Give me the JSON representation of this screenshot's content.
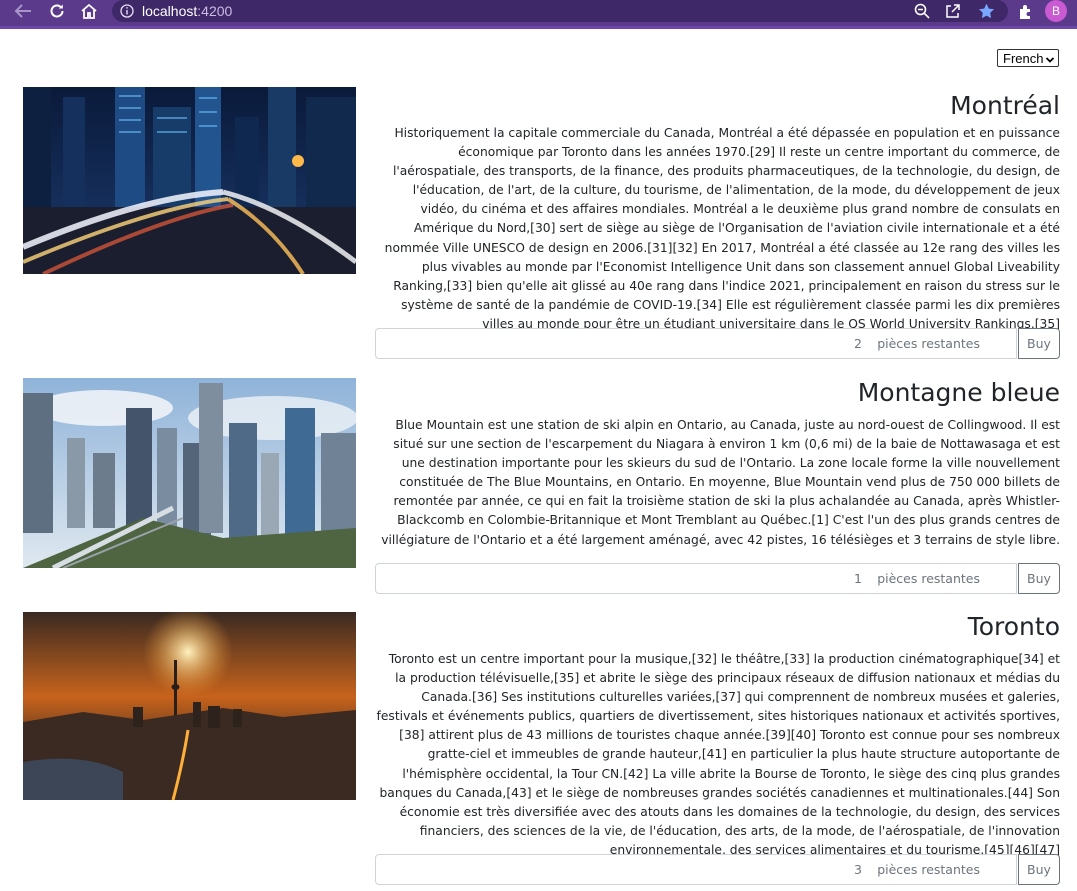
{
  "browser": {
    "url_host": "localhost",
    "url_port": ":4200",
    "profile_initial": "B",
    "colors": {
      "toolbar": "#5b3a8c",
      "urlbar": "#3f2868"
    },
    "icons": [
      "back-arrow-icon",
      "reload-icon",
      "home-icon",
      "info-icon",
      "zoom-icon",
      "share-icon",
      "star-icon",
      "extensions-icon"
    ]
  },
  "language": {
    "selected": "French"
  },
  "cities": [
    {
      "title": "Montréal",
      "description": "Historiquement la capitale commerciale du Canada, Montréal a été dépassée en population et en puissance économique par Toronto dans les années 1970.[29] Il reste un centre important du commerce, de l'aérospatiale, des transports, de la finance, des produits pharmaceutiques, de la technologie, du design, de l'éducation, de l'art, de la culture, du tourisme, de l'alimentation, de la mode, du développement de jeux vidéo, du cinéma et des affaires mondiales. Montréal a le deuxième plus grand nombre de consulats en Amérique du Nord,[30] sert de siège au siège de l'Organisation de l'aviation civile internationale et a été nommée Ville UNESCO de design en 2006.[31][32] En 2017, Montréal a été classée au 12e rang des villes les plus vivables au monde par l'Economist Intelligence Unit dans son classement annuel Global Liveability Ranking,[33] bien qu'elle ait glissé au 40e rang dans l'indice 2021, principalement en raison du stress sur le système de santé de la pandémie de COVID-19.[34] Elle est régulièrement classée parmi les dix premières villes au monde pour être un étudiant universitaire dans le QS World University Rankings.[35]",
      "quantity": "2",
      "remaining_label": "pièces restantes",
      "buy_label": "Buy"
    },
    {
      "title": "Montagne bleue",
      "description": "Blue Mountain est une station de ski alpin en Ontario, au Canada, juste au nord-ouest de Collingwood. Il est situé sur une section de l'escarpement du Niagara à environ 1 km (0,6 mi) de la baie de Nottawasaga et est une destination importante pour les skieurs du sud de l'Ontario. La zone locale forme la ville nouvellement constituée de The Blue Mountains, en Ontario. En moyenne, Blue Mountain vend plus de 750 000 billets de remontée par année, ce qui en fait la troisième station de ski la plus achalandée au Canada, après Whistler-Blackcomb en Colombie-Britannique et Mont Tremblant au Québec.[1] C'est l'un des plus grands centres de villégiature de l'Ontario et a été largement aménagé, avec 42 pistes, 16 télésièges et 3 terrains de style libre.",
      "quantity": "1",
      "remaining_label": "pièces restantes",
      "buy_label": "Buy"
    },
    {
      "title": "Toronto",
      "description": "Toronto est un centre important pour la musique,[32] le théâtre,[33] la production cinématographique[34] et la production télévisuelle,[35] et abrite le siège des principaux réseaux de diffusion nationaux et médias du Canada.[36] Ses institutions culturelles variées,[37] qui comprennent de nombreux musées et galeries, festivals et événements publics, quartiers de divertissement, sites historiques nationaux et activités sportives,[38] attirent plus de 43 millions de touristes chaque année.[39][40] Toronto est connue pour ses nombreux gratte-ciel et immeubles de grande hauteur,[41] en particulier la plus haute structure autoportante de l'hémisphère occidental, la Tour CN.[42] La ville abrite la Bourse de Toronto, le siège des cinq plus grandes banques du Canada,[43] et le siège de nombreuses grandes sociétés canadiennes et multinationales.[44] Son économie est très diversifiée avec des atouts dans les domaines de la technologie, du design, des services financiers, des sciences de la vie, de l'éducation, des arts, de la mode, de l'aérospatiale, de l'innovation environnementale, des services alimentaires et du tourisme.[45][46][47]",
      "quantity": "3",
      "remaining_label": "pièces restantes",
      "buy_label": "Buy"
    }
  ]
}
